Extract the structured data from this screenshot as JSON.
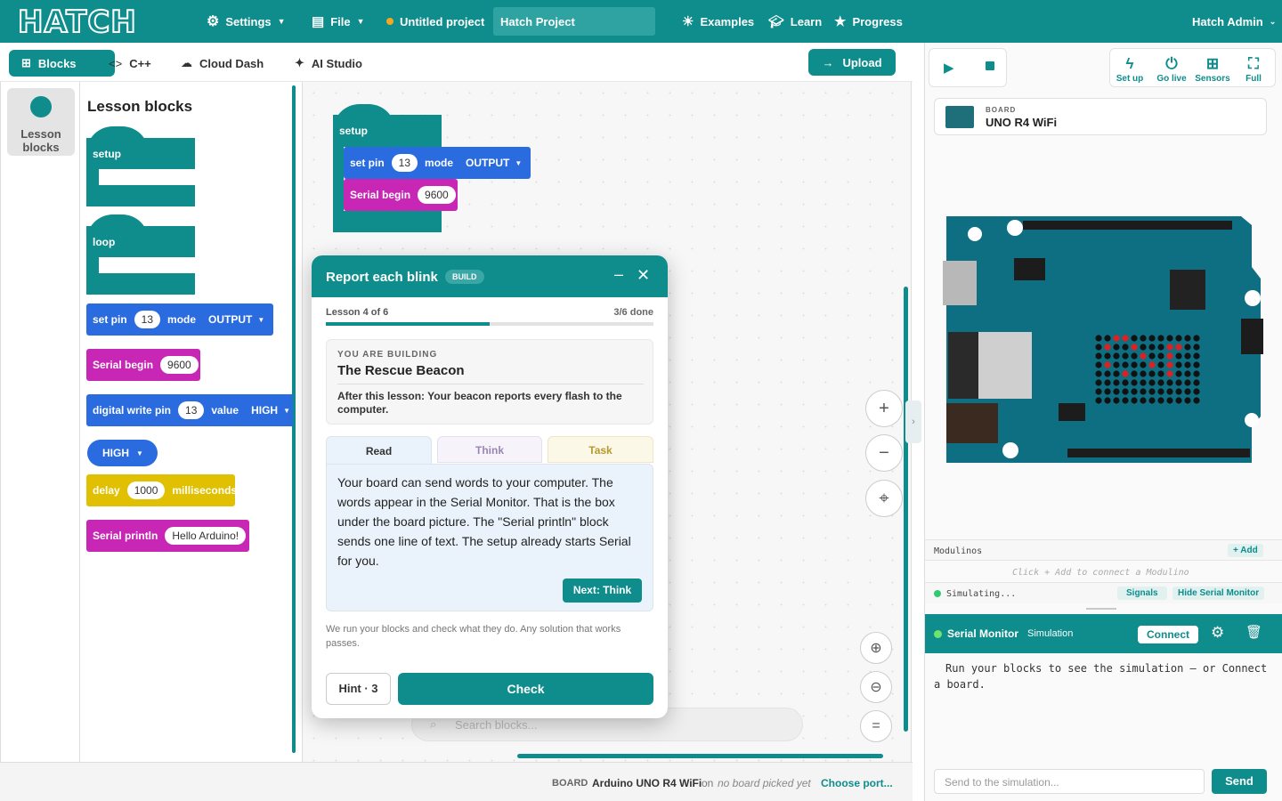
{
  "topbar": {
    "logo": "HATCH",
    "settings": "Settings",
    "file": "File",
    "untitled": "Untitled project",
    "project": "Hatch Project",
    "examples": "Examples",
    "learn": "Learn",
    "progress": "Progress",
    "user": "Hatch Admin"
  },
  "tabs": {
    "blocks": "Blocks",
    "cpp": "C++",
    "cloud": "Cloud Dash",
    "ai": "AI Studio",
    "upload": "Upload"
  },
  "category": {
    "label": "Lesson blocks"
  },
  "palette": {
    "title": "Lesson blocks",
    "setup": "setup",
    "loop": "loop",
    "setpin": "set pin",
    "pin13": "13",
    "mode": "mode",
    "output": "OUTPUT",
    "serial_begin": "Serial begin",
    "baud": "9600",
    "digital_write": "digital write pin",
    "value": "value",
    "high": "HIGH",
    "delay": "delay",
    "delay_val": "1000",
    "ms": "milliseconds",
    "println": "Serial println",
    "println_val": "Hello Arduino!"
  },
  "workspace": {
    "setup": "setup",
    "setpin": "set pin",
    "pin": "13",
    "mode": "mode",
    "output": "OUTPUT",
    "serial_begin": "Serial begin",
    "baud": "9600",
    "search_placeholder": "Search blocks..."
  },
  "lesson": {
    "title": "Report each blink",
    "badge": "BUILD",
    "progress_label": "Lesson 4 of 6",
    "done": "3/6 done",
    "progress_fraction": 0.5,
    "building_label": "YOU ARE BUILDING",
    "building_title": "The Rescue Beacon",
    "after": "After this lesson: Your beacon reports every flash to the computer.",
    "tabs": [
      "Read",
      "Think",
      "Task"
    ],
    "body": "Your board can send words to your computer. The words appear in the Serial Monitor. That is the box under the board picture. The \"Serial println\" block sends one line of text. The setup already starts Serial for you.",
    "next": "Next: Think",
    "note": "We run your blocks and check what they do. Any solution that works passes.",
    "hint": "Hint · 3",
    "check": "Check"
  },
  "status": {
    "board_label": "BOARD",
    "board": "Arduino UNO R4 WiFi",
    "on": "on",
    "none": "no board picked yet",
    "port": "Choose port..."
  },
  "right": {
    "setup": "Set up",
    "golive": "Go live",
    "sensors": "Sensors",
    "full": "Full",
    "board_label": "BOARD",
    "board_name": "UNO R4 WiFi",
    "modulinos": "Modulinos",
    "add": "+ Add",
    "modulino_hint": "Click + Add to connect a Modulino",
    "simulating": "Simulating...",
    "signals": "Signals",
    "hide_monitor": "Hide Serial Monitor",
    "monitor_title": "Serial Monitor",
    "monitor_mode": "Simulation",
    "connect": "Connect",
    "monitor_text": "Run your blocks to see the simulation – or Connect a board.",
    "send_placeholder": "Send to the simulation...",
    "send": "Send"
  },
  "colors": {
    "teal": "#0f8c8c",
    "blue": "#2a6be0",
    "magenta": "#c827b5",
    "yellow": "#e0c000"
  }
}
